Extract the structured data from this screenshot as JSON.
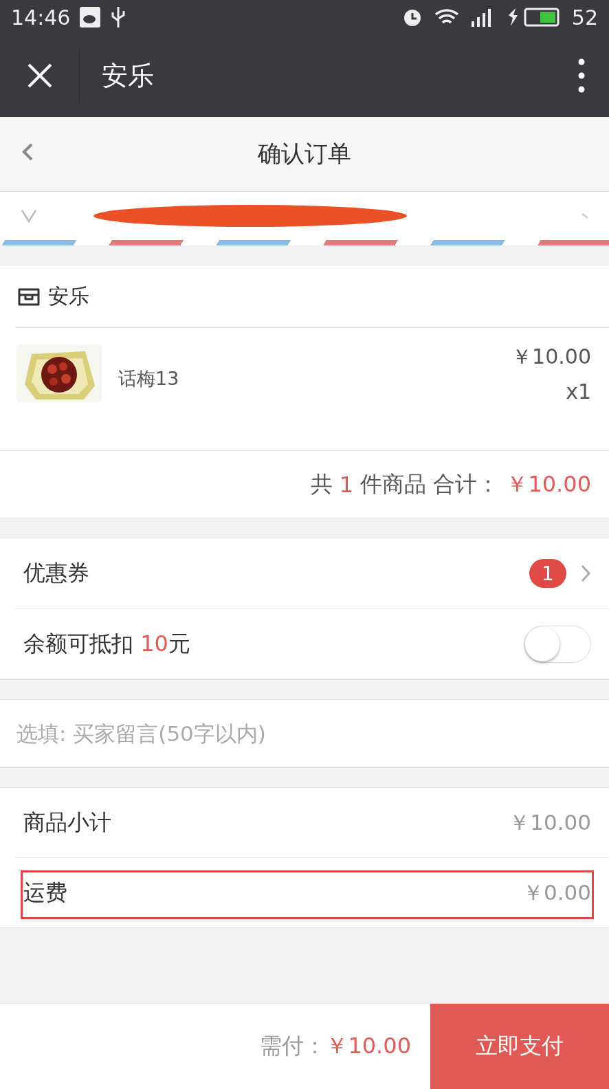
{
  "status_bar": {
    "time": "14:46",
    "battery": "52"
  },
  "app_bar": {
    "title": "安乐"
  },
  "nav": {
    "title": "确认订单"
  },
  "shop": {
    "name": "安乐"
  },
  "product": {
    "name": "话梅13",
    "price": "￥10.00",
    "quantity": "x1"
  },
  "order_total": {
    "prefix": "共",
    "count": "1",
    "middle": "件商品 合计：",
    "total": "￥10.00"
  },
  "coupon": {
    "label": "优惠券",
    "badge": "1"
  },
  "balance": {
    "label": "余额可抵扣",
    "amount": "10",
    "unit": "元",
    "on": false
  },
  "message": {
    "placeholder": "选填: 买家留言(50字以内)"
  },
  "summary": [
    {
      "label": "商品小计",
      "value": "￥10.00",
      "highlighted": false
    },
    {
      "label": "运费",
      "value": "￥0.00",
      "highlighted": true
    }
  ],
  "footer": {
    "label": "需付：",
    "amount": "￥10.00",
    "button": "立即支付"
  }
}
